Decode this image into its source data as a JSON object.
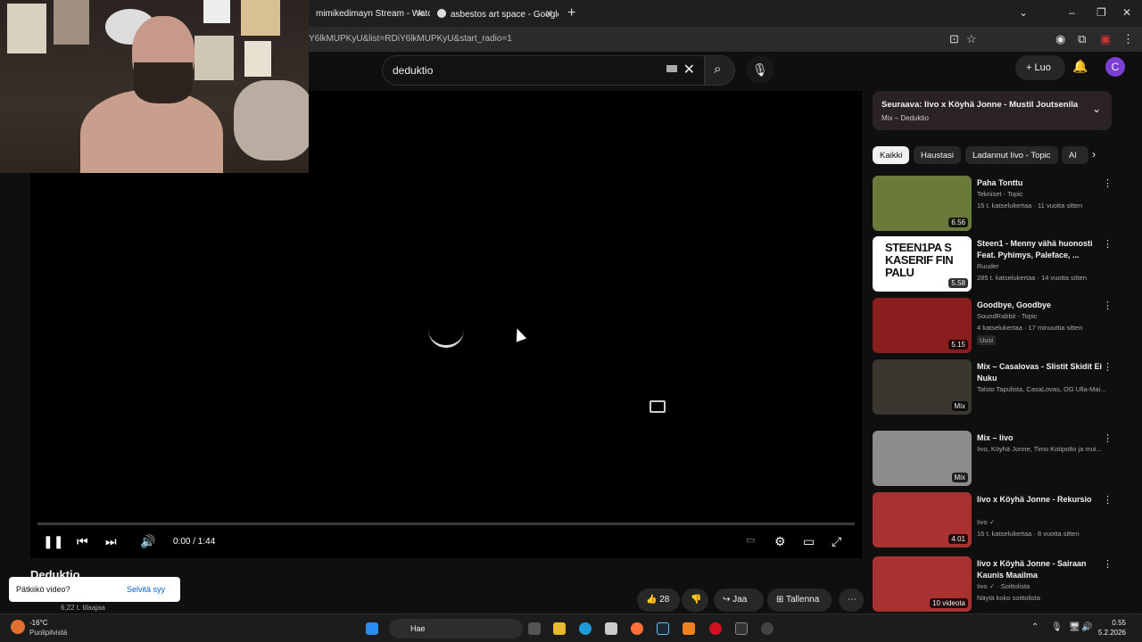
{
  "browser": {
    "tabs": [
      {
        "label": "mimikedimayn Stream - Watch l"
      },
      {
        "label": "asbestos art space - Google-ha"
      }
    ],
    "url": "Y6lkMUPKyU&list=RDiY6lkMUPKyU&start_radio=1"
  },
  "header": {
    "search_value": "deduktio",
    "create_label": "Luo",
    "avatar_letter": "C"
  },
  "player": {
    "time": "0:00 / 1:44",
    "progress": 0
  },
  "video": {
    "title": "Deduktio",
    "subscribers": "6,22 t. tilaajaa",
    "likes": "28",
    "share_label": "Jaa",
    "save_label": "Tallenna"
  },
  "toast": {
    "question": "Pätkiikö video?",
    "action": "Selvitä syy"
  },
  "sidebar": {
    "upnext": {
      "title": "Seuraava: Iivo x Köyhä Jonne - Mustil Joutsenila",
      "subtitle": "Mix – Deduktio"
    },
    "chips": [
      "Kaikki",
      "Haustasi",
      "Ladannut Iivo - Topic",
      "Al"
    ],
    "videos": [
      {
        "title": "Paha Tonttu",
        "channel": "Tekniset - Topic",
        "meta": "15 t. katselukertaa · 11 vuotta sitten",
        "duration": "6.56",
        "thumb": "#6a7a3a"
      },
      {
        "title": "Steen1 - Menny vähä huonosti Feat. Pyhimys, Paleface, ...",
        "channel": "Ruuder",
        "meta": "285 t. katselukertaa · 14 vuotta sitten",
        "duration": "5.58",
        "thumb": "#ffffff",
        "thumb_text": "STEEN1PA SKASERIF FINPALU"
      },
      {
        "title": "Goodbye, Goodbye",
        "channel": "SoundRabbit - Topic",
        "meta": "4 katselukertaa · 17 minuuttia sitten",
        "badge": "Uusi",
        "duration": "5.15",
        "thumb": "#8a1e1e"
      },
      {
        "title": "Mix – Casalovas - Slistit Skidit Ei Nuku",
        "channel": "Talsto Tapulista, CasaLovas, OG Ulla-Mai...",
        "duration": "Mix",
        "thumb": "#3a3630"
      },
      {
        "title": "Mix – Iivo",
        "channel": "Iivo, Köyhä Jonne, Timo Kotipolto ja mui...",
        "duration": "Mix",
        "thumb": "#8c8c8c"
      },
      {
        "title": "Iivo x Köyhä Jonne - Rekursio",
        "channel": "Iivo ✓",
        "meta": "16 t. katselukertaa · 8 vuotta sitten",
        "duration": "4.01",
        "thumb": "#a83232"
      },
      {
        "title": "Iivo x Köyhä Jonne - Sairaan Kaunis Maailma",
        "channel": "Iivo ✓ · Soittolista",
        "meta": "Näytä koko soittolista",
        "duration": "10 videota",
        "thumb": "#a83232"
      }
    ]
  },
  "taskbar": {
    "temp": "-16°C",
    "weather": "Puolipilvistä",
    "search": "Hae",
    "time": "0.55",
    "date": "5.2.2026"
  }
}
